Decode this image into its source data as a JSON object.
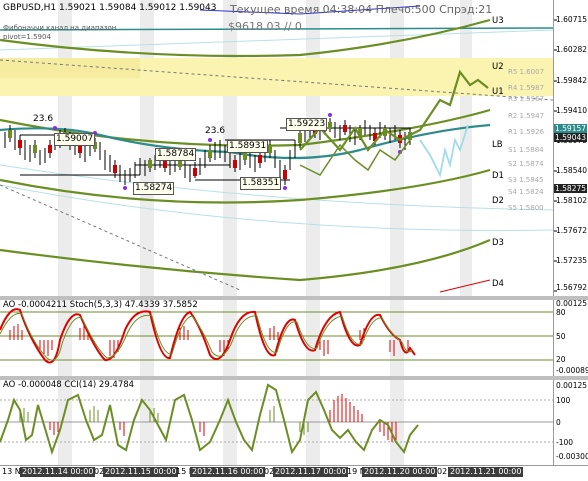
{
  "header": {
    "symbol_line": "GBPUSD,H1  1.59021 1.59084 1.59012 1.59043",
    "status": "Текущее время 04:38:04 Плечо:500 Спрэд:21",
    "subline": "Фибоначчи канал на диапазон",
    "value_line": "$9618.03   //  0",
    "pivot_line": "pivot=1.5904"
  },
  "main_axis": {
    "ticks": [
      "1.60715",
      "1.60282",
      "1.59842",
      "1.59410",
      "1.58975",
      "1.58540",
      "1.58102",
      "1.57672",
      "1.57235",
      "1.56792"
    ],
    "price_tag": "1.59157",
    "last_tag": "1.59043",
    "bottom_tag": "1.58275"
  },
  "channel_labels": {
    "u3": "U3",
    "u2": "U2",
    "u1": "U1",
    "lb": "LB",
    "d1": "D1",
    "d2": "D2",
    "d3": "D3",
    "d4": "D4"
  },
  "pivot_levels": {
    "r5": "R5 1.6007",
    "r4": "R4 1.5987",
    "r3": "R3 1.5967",
    "r2": "R2 1.5947",
    "r1": "R1 1.5926",
    "s1": "S1 1.5884",
    "s2": "S2 1.5874",
    "s3": "S3 1.5845",
    "s4": "S4 1.5824",
    "s5": "S5 1.5800"
  },
  "fib_labels": {
    "left": "23.6",
    "mid": "23.6"
  },
  "price_boxes": {
    "b1": "1.59007",
    "b2": "1.58784",
    "b3": "1.58931",
    "b4": "1.59223",
    "b5": "1.58274",
    "b6": "1.58351"
  },
  "ao_stoch": {
    "title": "AO -0.0004211  Stoch(5,3,3) 47.4339 37.5852",
    "ticks": [
      "0.00125",
      "80",
      "50",
      "20",
      "-0.00089"
    ]
  },
  "ao_cci": {
    "title": "AO -0.000048  CCI(14) 29.4784",
    "ticks": [
      "0.00125",
      "100",
      "0",
      "-100",
      "-0.00300"
    ]
  },
  "time_axis": {
    "labels": [
      "13 N",
      "2012.11.14 00:00",
      "02:",
      "2012.11.15 00:00",
      "15 N",
      "2012.11.16 00:00",
      "02:",
      "2012.11.17 00:00",
      "19 N",
      "2012.11.20 00:00",
      "02:",
      "2012.11.21 00:00"
    ]
  },
  "colors": {
    "olive": "#6b8e23",
    "teal": "#2e8b8b",
    "red": "#e00000",
    "band": "#fbf3b0"
  }
}
